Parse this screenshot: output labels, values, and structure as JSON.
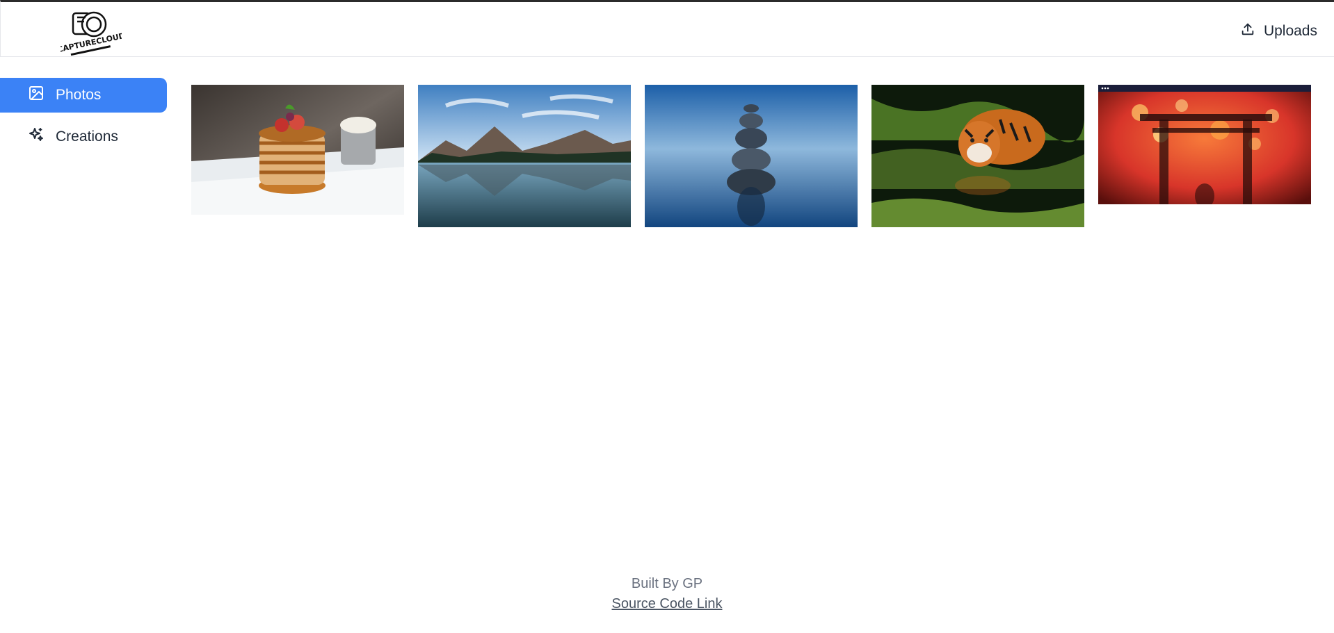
{
  "header": {
    "logo": {
      "name": "capturecloud-logo",
      "text": "CAPTURECLOUD"
    },
    "uploads_label": "Uploads",
    "uploads_icon": "upload-icon"
  },
  "sidebar": {
    "items": [
      {
        "label": "Photos",
        "icon": "image-icon",
        "active": true
      },
      {
        "label": "Creations",
        "icon": "sparkles-icon",
        "active": false
      }
    ],
    "accent_color": "#3b82f6"
  },
  "gallery": {
    "photos": [
      {
        "subject": "pancakes"
      },
      {
        "subject": "mountain-lake"
      },
      {
        "subject": "stacked-stones"
      },
      {
        "subject": "tiger"
      },
      {
        "subject": "torii-gate"
      }
    ]
  },
  "footer": {
    "built_by": "Built By GP",
    "source_link": "Source Code Link"
  }
}
